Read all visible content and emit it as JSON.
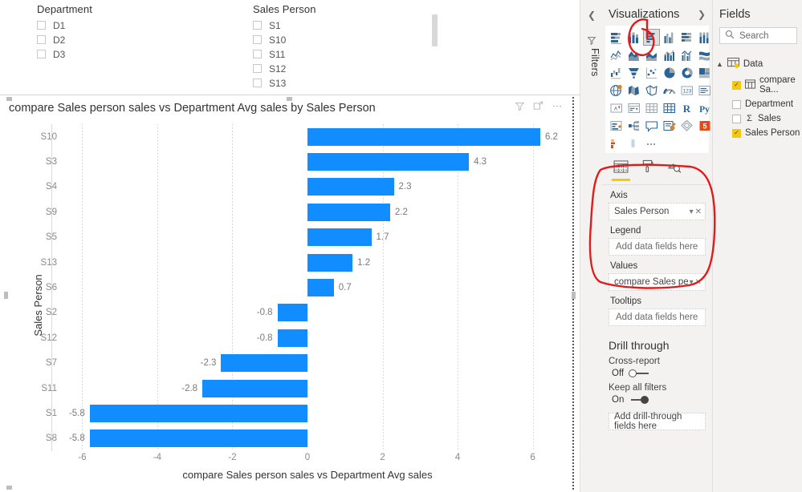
{
  "canvas": {
    "slicers": [
      {
        "name": "department",
        "title": "Department",
        "items": [
          {
            "label": "D1",
            "checked": false
          },
          {
            "label": "D2",
            "checked": false
          },
          {
            "label": "D3",
            "checked": false
          }
        ]
      },
      {
        "name": "sales-person",
        "title": "Sales Person",
        "items": [
          {
            "label": "S1",
            "checked": false
          },
          {
            "label": "S10",
            "checked": false
          },
          {
            "label": "S11",
            "checked": false
          },
          {
            "label": "S12",
            "checked": false
          },
          {
            "label": "S13",
            "checked": false
          }
        ]
      }
    ]
  },
  "visual": {
    "title": "compare Sales person sales vs Department Avg sales by Sales Person",
    "header_icons": [
      "filter-icon",
      "focus-mode-icon",
      "more-options-icon"
    ]
  },
  "chart_data": {
    "type": "bar",
    "orientation": "horizontal",
    "title": "compare Sales person sales vs Department Avg sales by Sales Person",
    "xlabel": "compare Sales person sales vs Department Avg sales",
    "ylabel": "Sales Person",
    "categories": [
      "S10",
      "S3",
      "S4",
      "S9",
      "S5",
      "S13",
      "S6",
      "S2",
      "S12",
      "S7",
      "S11",
      "S1",
      "S8"
    ],
    "values": [
      6.2,
      4.3,
      2.3,
      2.2,
      1.7,
      1.2,
      0.7,
      -0.8,
      -0.8,
      -2.3,
      -2.8,
      -5.8,
      -5.8
    ],
    "data_labels": [
      "6.2",
      "4.3",
      "2.3",
      "2.2",
      "1.7",
      "1.2",
      "0.7",
      "-0.8",
      "-0.8",
      "-2.3",
      "-2.8",
      "-5.8",
      "-5.8"
    ],
    "xticks": [
      -6,
      -4,
      -2,
      0,
      2,
      4,
      6
    ],
    "xtick_labels": [
      "-6",
      "-4",
      "-2",
      "0",
      "2",
      "4",
      "6"
    ],
    "xlim": [
      -6.8,
      6.8
    ],
    "grid": true,
    "legend": "none",
    "series_color": "#118DFF"
  },
  "filters_rail": {
    "collapse_icon": "chevron-left-icon",
    "filter_icon": "filter-funnel-icon",
    "label": "Filters"
  },
  "visualizations_pane": {
    "title": "Visualizations",
    "expand_icon": "chevron-right-icon",
    "gallery": [
      {
        "name": "stacked-bar-chart",
        "selected": false
      },
      {
        "name": "stacked-column-chart",
        "selected": false
      },
      {
        "name": "clustered-bar-chart",
        "selected": true
      },
      {
        "name": "clustered-column-chart",
        "selected": false
      },
      {
        "name": "100-percent-stacked-bar-chart",
        "selected": false
      },
      {
        "name": "100-percent-stacked-column-chart",
        "selected": false
      },
      {
        "name": "line-chart",
        "selected": false
      },
      {
        "name": "area-chart",
        "selected": false
      },
      {
        "name": "stacked-area-chart",
        "selected": false
      },
      {
        "name": "line-and-stacked-column-chart",
        "selected": false
      },
      {
        "name": "line-and-clustered-column-chart",
        "selected": false
      },
      {
        "name": "ribbon-chart",
        "selected": false
      },
      {
        "name": "waterfall-chart",
        "selected": false
      },
      {
        "name": "funnel-chart",
        "selected": false
      },
      {
        "name": "scatter-chart",
        "selected": false
      },
      {
        "name": "pie-chart",
        "selected": false
      },
      {
        "name": "donut-chart",
        "selected": false
      },
      {
        "name": "treemap-chart",
        "selected": false
      },
      {
        "name": "map-visual",
        "selected": false
      },
      {
        "name": "filled-map-visual",
        "selected": false
      },
      {
        "name": "shape-map-visual",
        "selected": false
      },
      {
        "name": "gauge-visual",
        "selected": false
      },
      {
        "name": "card-visual",
        "selected": false
      },
      {
        "name": "multi-row-card-visual",
        "selected": false
      },
      {
        "name": "kpi-visual",
        "selected": false
      },
      {
        "name": "slicer-visual",
        "selected": false
      },
      {
        "name": "table-visual",
        "selected": false
      },
      {
        "name": "matrix-visual",
        "selected": false
      },
      {
        "name": "r-script-visual",
        "selected": false
      },
      {
        "name": "python-script-visual",
        "selected": false
      },
      {
        "name": "key-influencers-visual",
        "selected": false
      },
      {
        "name": "decomposition-tree-visual",
        "selected": false
      },
      {
        "name": "qa-visual",
        "selected": false
      },
      {
        "name": "smart-narrative-visual",
        "selected": false
      },
      {
        "name": "paginated-report-visual",
        "selected": false
      },
      {
        "name": "power-apps-visual",
        "selected": false
      },
      {
        "name": "arcgis-maps-visual",
        "selected": false
      },
      {
        "name": "scroller-visual",
        "selected": false
      },
      {
        "name": "get-more-visuals",
        "selected": false
      }
    ],
    "tabs": [
      {
        "name": "fields-tab",
        "icon": "fields-grid-icon",
        "active": true
      },
      {
        "name": "format-tab",
        "icon": "paint-roller-icon",
        "active": false
      },
      {
        "name": "analytics-tab",
        "icon": "magnifier-chart-icon",
        "active": false
      }
    ],
    "wells": [
      {
        "label": "Axis",
        "field": "Sales Person",
        "placeholder": "",
        "has_field": true
      },
      {
        "label": "Legend",
        "field": "",
        "placeholder": "Add data fields here",
        "has_field": false
      },
      {
        "label": "Values",
        "field": "compare Sales person s",
        "placeholder": "",
        "has_field": true
      },
      {
        "label": "Tooltips",
        "field": "",
        "placeholder": "Add data fields here",
        "has_field": false
      }
    ],
    "drill_through": {
      "title": "Drill through",
      "cross_report_label": "Cross-report",
      "cross_report_state": "Off",
      "keep_all_filters_label": "Keep all filters",
      "keep_all_filters_state": "On",
      "dropzone": "Add drill-through fields here"
    }
  },
  "fields_pane": {
    "title": "Fields",
    "search_placeholder": "Search",
    "search_icon": "search-icon",
    "tree": {
      "root": {
        "label": "Data",
        "expanded": true,
        "chevron": "chevron-up-icon"
      },
      "items": [
        {
          "label": "compare Sa...",
          "checked": true,
          "kind": "measure-table"
        },
        {
          "label": "Department",
          "checked": false,
          "kind": "field"
        },
        {
          "label": "Sales",
          "checked": false,
          "kind": "sum-field"
        },
        {
          "label": "Sales Person",
          "checked": true,
          "kind": "field"
        }
      ]
    }
  },
  "annotations": {
    "color": "#E01B1B",
    "marks": [
      "circle-around-clustered-bar-icon",
      "oval-around-axis-values-wells"
    ]
  }
}
